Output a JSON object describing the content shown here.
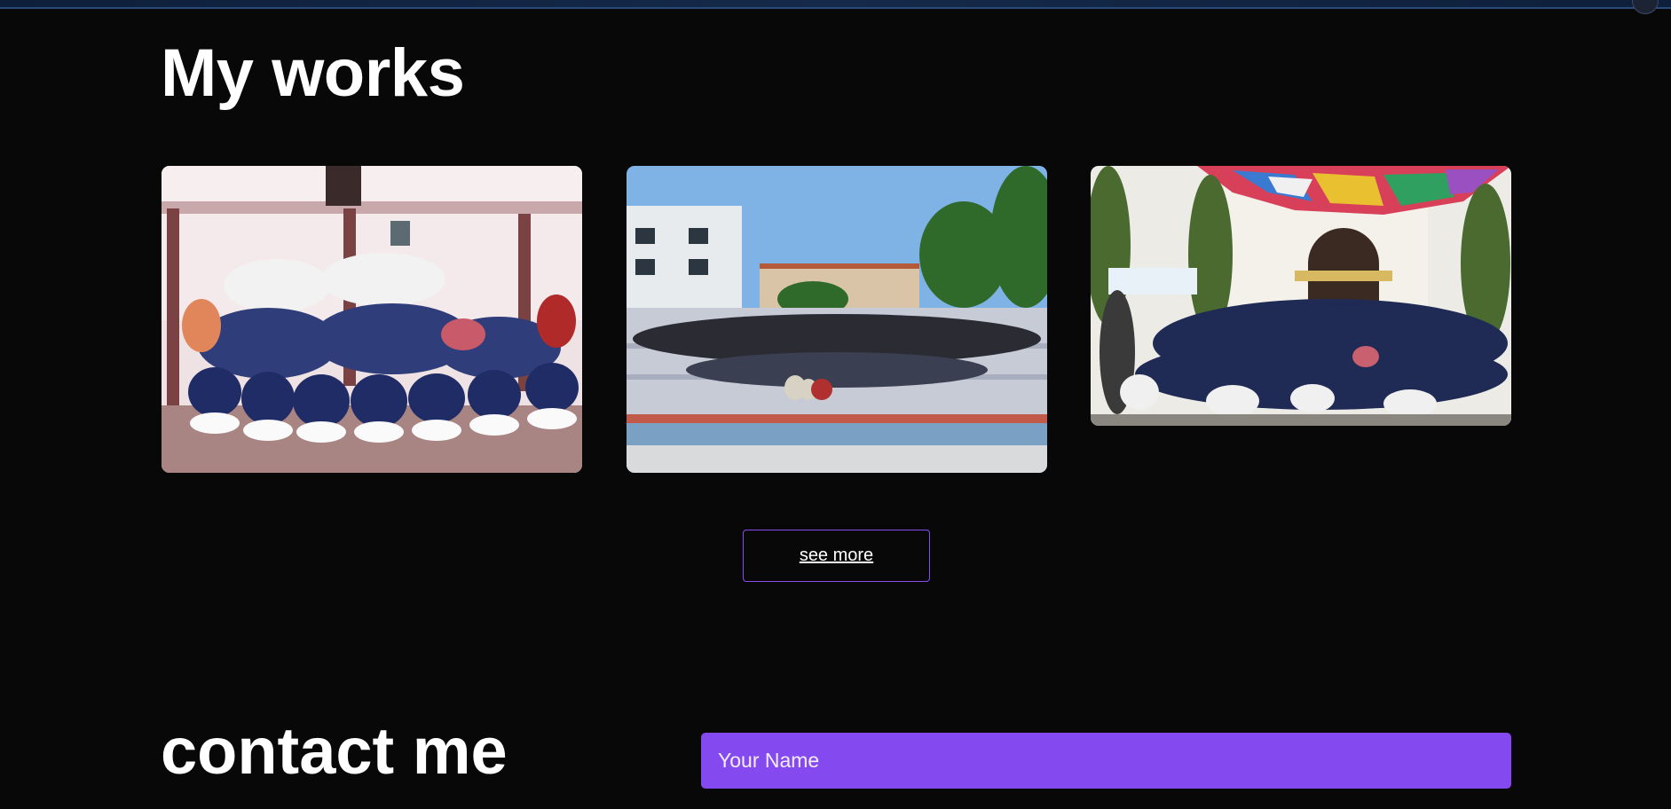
{
  "works": {
    "title": "My works",
    "photos": [
      {
        "icon": "group-photo-image",
        "subject": "students in uniform posing in a hallway"
      },
      {
        "icon": "group-photo-image",
        "subject": "large group seated on amphitheatre steps outside college"
      },
      {
        "icon": "group-photo-image",
        "subject": "crowd posing under colourful canopy in front of building"
      }
    ],
    "see_more_label": "see more"
  },
  "contact": {
    "title": "contact me",
    "name_placeholder": "Your Name"
  },
  "colors": {
    "background": "#080808",
    "accent": "#8449ef",
    "button_border": "#8a4cf0",
    "text": "#ffffff"
  }
}
